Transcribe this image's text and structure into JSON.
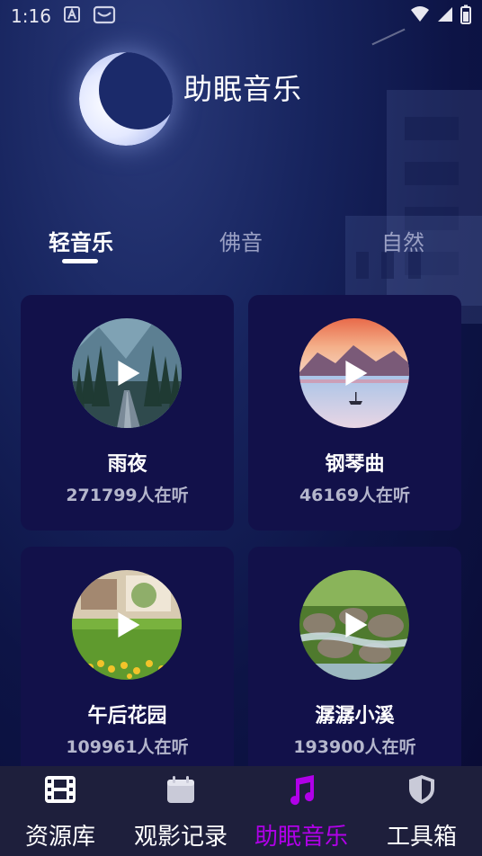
{
  "status_bar": {
    "time": "1:16"
  },
  "header": {
    "title": "助眠音乐"
  },
  "tabs": [
    {
      "label": "轻音乐",
      "active": true
    },
    {
      "label": "佛音",
      "active": false
    },
    {
      "label": "自然",
      "active": false
    }
  ],
  "cards": [
    {
      "title": "雨夜",
      "listeners": "271799人在听",
      "image": "rainy-forest-road"
    },
    {
      "title": "钢琴曲",
      "listeners": "46169人在听",
      "image": "mountain-lake-sunset"
    },
    {
      "title": "午后花园",
      "listeners": "109961人在听",
      "image": "garden-lawn-flowers"
    },
    {
      "title": "潺潺小溪",
      "listeners": "193900人在听",
      "image": "stream-rocks-moss"
    }
  ],
  "bottom_nav": [
    {
      "label": "资源库",
      "icon": "film-icon",
      "active": false
    },
    {
      "label": "观影记录",
      "icon": "calendar-icon",
      "active": false
    },
    {
      "label": "助眠音乐",
      "icon": "music-note-icon",
      "active": true
    },
    {
      "label": "工具箱",
      "icon": "shield-icon",
      "active": false
    }
  ],
  "colors": {
    "accent": "#b000e8",
    "card_bg": "#12114a",
    "nav_bg": "#1e1f3c"
  }
}
